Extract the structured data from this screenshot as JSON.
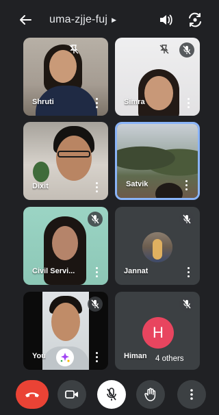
{
  "header": {
    "meeting_code": "uma-zjje-fuj",
    "icons": {
      "back": "arrow-back-icon",
      "caret": "caret-right-icon",
      "speaker": "volume-icon",
      "switch_camera": "switch-camera-icon"
    }
  },
  "participants": [
    {
      "name": "Shruti",
      "mic_muted": false,
      "pin_off_shown": true
    },
    {
      "name": "Simra",
      "mic_muted": true,
      "pin_off_shown": true
    },
    {
      "name": "Dixit",
      "mic_muted": false
    },
    {
      "name": "Satvik",
      "mic_muted": false,
      "active_speaker": true
    },
    {
      "name": "Civil Servi...",
      "mic_muted": true
    },
    {
      "name": "Jannat",
      "mic_muted": true,
      "avatar": "photo"
    },
    {
      "name": "You",
      "mic_muted": true,
      "effects_button": true
    },
    {
      "name": "Himan",
      "mic_muted": true,
      "avatar_letter": "H",
      "overflow_label": "4 others"
    }
  ],
  "controls": {
    "end_call": "call-end-icon",
    "camera": "videocam-icon",
    "mic": "mic-off-icon",
    "raise_hand": "hand-icon",
    "more": "more-vert-icon"
  },
  "colors": {
    "background": "#202124",
    "tile": "#3c4043",
    "active_border": "#8ab4f8",
    "end_call": "#ea4335",
    "avatar_letter_bg": "#e8455f"
  }
}
